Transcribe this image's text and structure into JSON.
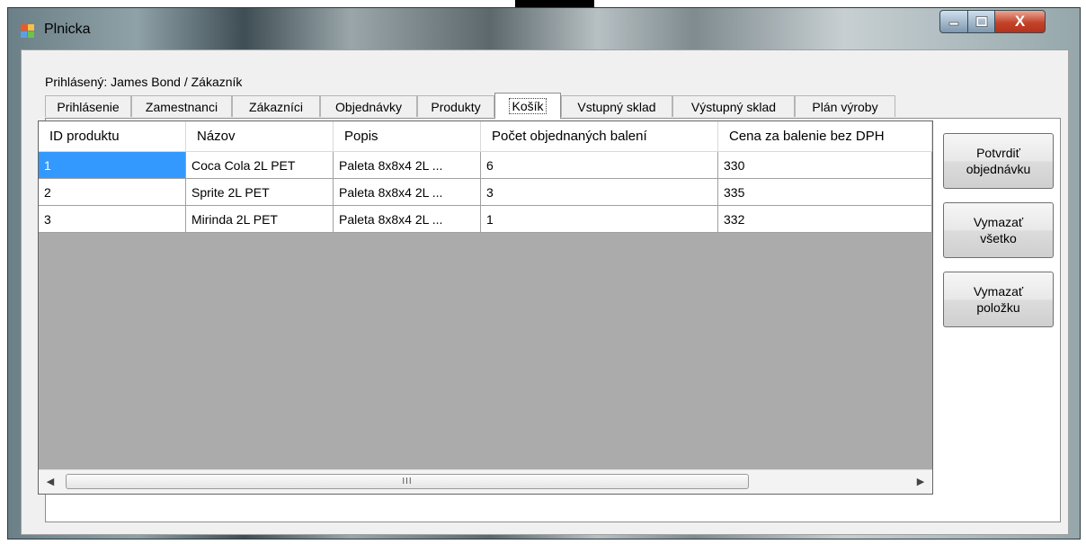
{
  "window": {
    "title": "Plnicka",
    "close_glyph": "X"
  },
  "login_label": "Prihlásený: James Bond / Zákazník",
  "tabs": [
    {
      "label": "Prihlásenie"
    },
    {
      "label": "Zamestnanci"
    },
    {
      "label": "Zákazníci"
    },
    {
      "label": "Objednávky"
    },
    {
      "label": "Produkty"
    },
    {
      "label": "Košík",
      "active": true
    },
    {
      "label": "Vstupný sklad"
    },
    {
      "label": "Výstupný sklad"
    },
    {
      "label": "Plán výroby"
    }
  ],
  "grid": {
    "columns": [
      "ID produktu",
      "Názov",
      "Popis",
      "Počet objednaných balení",
      "Cena za balenie bez DPH"
    ],
    "rows": [
      [
        "1",
        "Coca Cola 2L PET",
        "Paleta 8x8x4 2L ...",
        "6",
        "330"
      ],
      [
        "2",
        "Sprite 2L PET",
        "Paleta 8x8x4 2L ...",
        "3",
        "335"
      ],
      [
        "3",
        "Mirinda 2L PET",
        "Paleta 8x8x4 2L ...",
        "1",
        "332"
      ]
    ],
    "scroll_left_glyph": "◀",
    "scroll_right_glyph": "▶",
    "scroll_thumb_glyph": "III"
  },
  "buttons": {
    "confirm": {
      "line1": "Potvrdiť",
      "line2": "objednávku"
    },
    "clear_all": {
      "line1": "Vymazať",
      "line2": "všetko"
    },
    "delete_item": {
      "line1": "Vymazať",
      "line2": "položku"
    }
  },
  "colors": {
    "selection": "#3399ff",
    "grid_background": "#ababab",
    "close_button": "#c4432a"
  },
  "icons": {
    "app": "app-grid-icon",
    "minimize": "minimize-icon",
    "maximize": "maximize-icon",
    "close": "close-icon"
  }
}
